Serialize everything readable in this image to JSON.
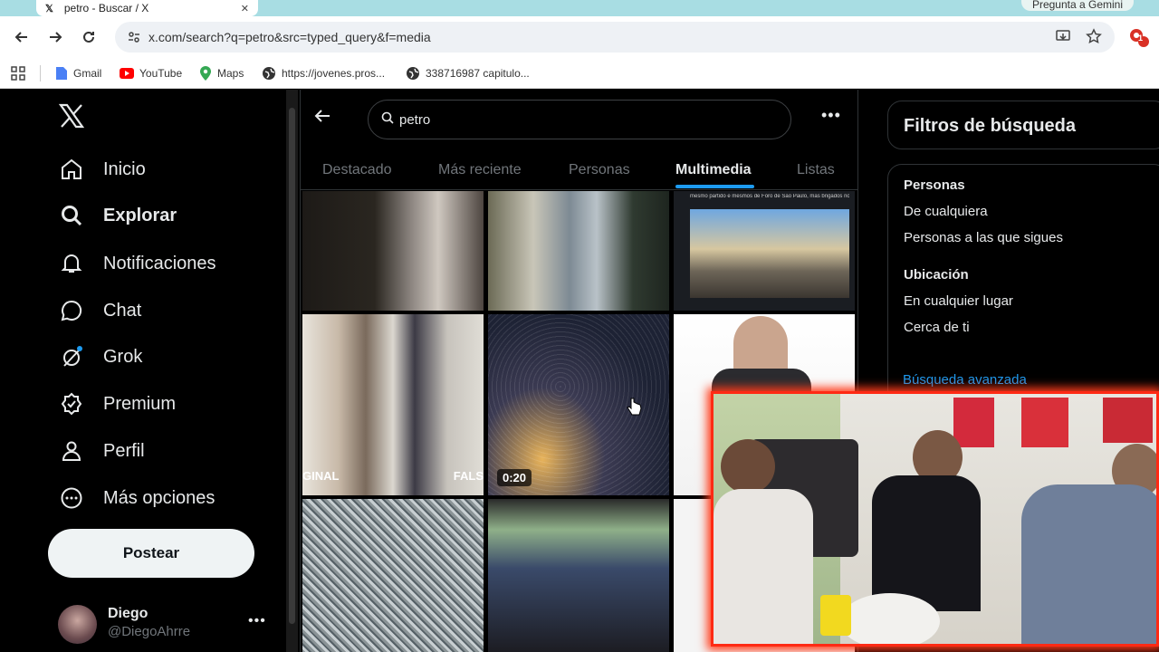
{
  "browser": {
    "tab_title": "petro - Buscar / X",
    "gemini_label": "Pregunta a Gemini",
    "url": "x.com/search?q=petro&src=typed_query&f=media",
    "extension_badge": "1",
    "bookmarks": [
      {
        "label": "Gmail",
        "icon": "gmail-icon"
      },
      {
        "label": "YouTube",
        "icon": "youtube-icon"
      },
      {
        "label": "Maps",
        "icon": "maps-icon"
      },
      {
        "label": "https://jovenes.pros...",
        "icon": "globe-icon"
      },
      {
        "label": "338716987 capitulo...",
        "icon": "globe-icon"
      }
    ]
  },
  "sidebar": {
    "logo": "x-logo",
    "items": [
      {
        "label": "Inicio",
        "icon": "home-icon"
      },
      {
        "label": "Explorar",
        "icon": "search-icon"
      },
      {
        "label": "Notificaciones",
        "icon": "bell-icon"
      },
      {
        "label": "Chat",
        "icon": "chat-icon"
      },
      {
        "label": "Grok",
        "icon": "grok-icon"
      },
      {
        "label": "Premium",
        "icon": "verified-icon"
      },
      {
        "label": "Perfil",
        "icon": "person-icon"
      },
      {
        "label": "Más opciones",
        "icon": "more-circle-icon"
      }
    ],
    "post_button": "Postear",
    "user": {
      "name": "Diego",
      "handle": "@DiegoAhrre"
    }
  },
  "search": {
    "query": "petro",
    "tabs": [
      "Destacado",
      "Más reciente",
      "Personas",
      "Multimedia",
      "Listas"
    ],
    "active_tab": "Multimedia"
  },
  "media": {
    "tile_labels": {
      "left_overlay": "GINAL",
      "right_overlay": "FALS"
    },
    "video_duration": "0:20",
    "headline_snippet": "mesmo partido e mesmos de Foro de São Paulo, mas brigados no..."
  },
  "filters": {
    "title": "Filtros de búsqueda",
    "people_heading": "Personas",
    "people_options": [
      "De cualquiera",
      "Personas a las que sigues"
    ],
    "location_heading": "Ubicación",
    "location_options": [
      "En cualquier lugar",
      "Cerca de ti"
    ],
    "advanced_link": "Búsqueda avanzada"
  },
  "colors": {
    "accent": "#1d9bf0",
    "webcam_border": "#ff2a14",
    "tab_strip": "#a8dde3"
  }
}
